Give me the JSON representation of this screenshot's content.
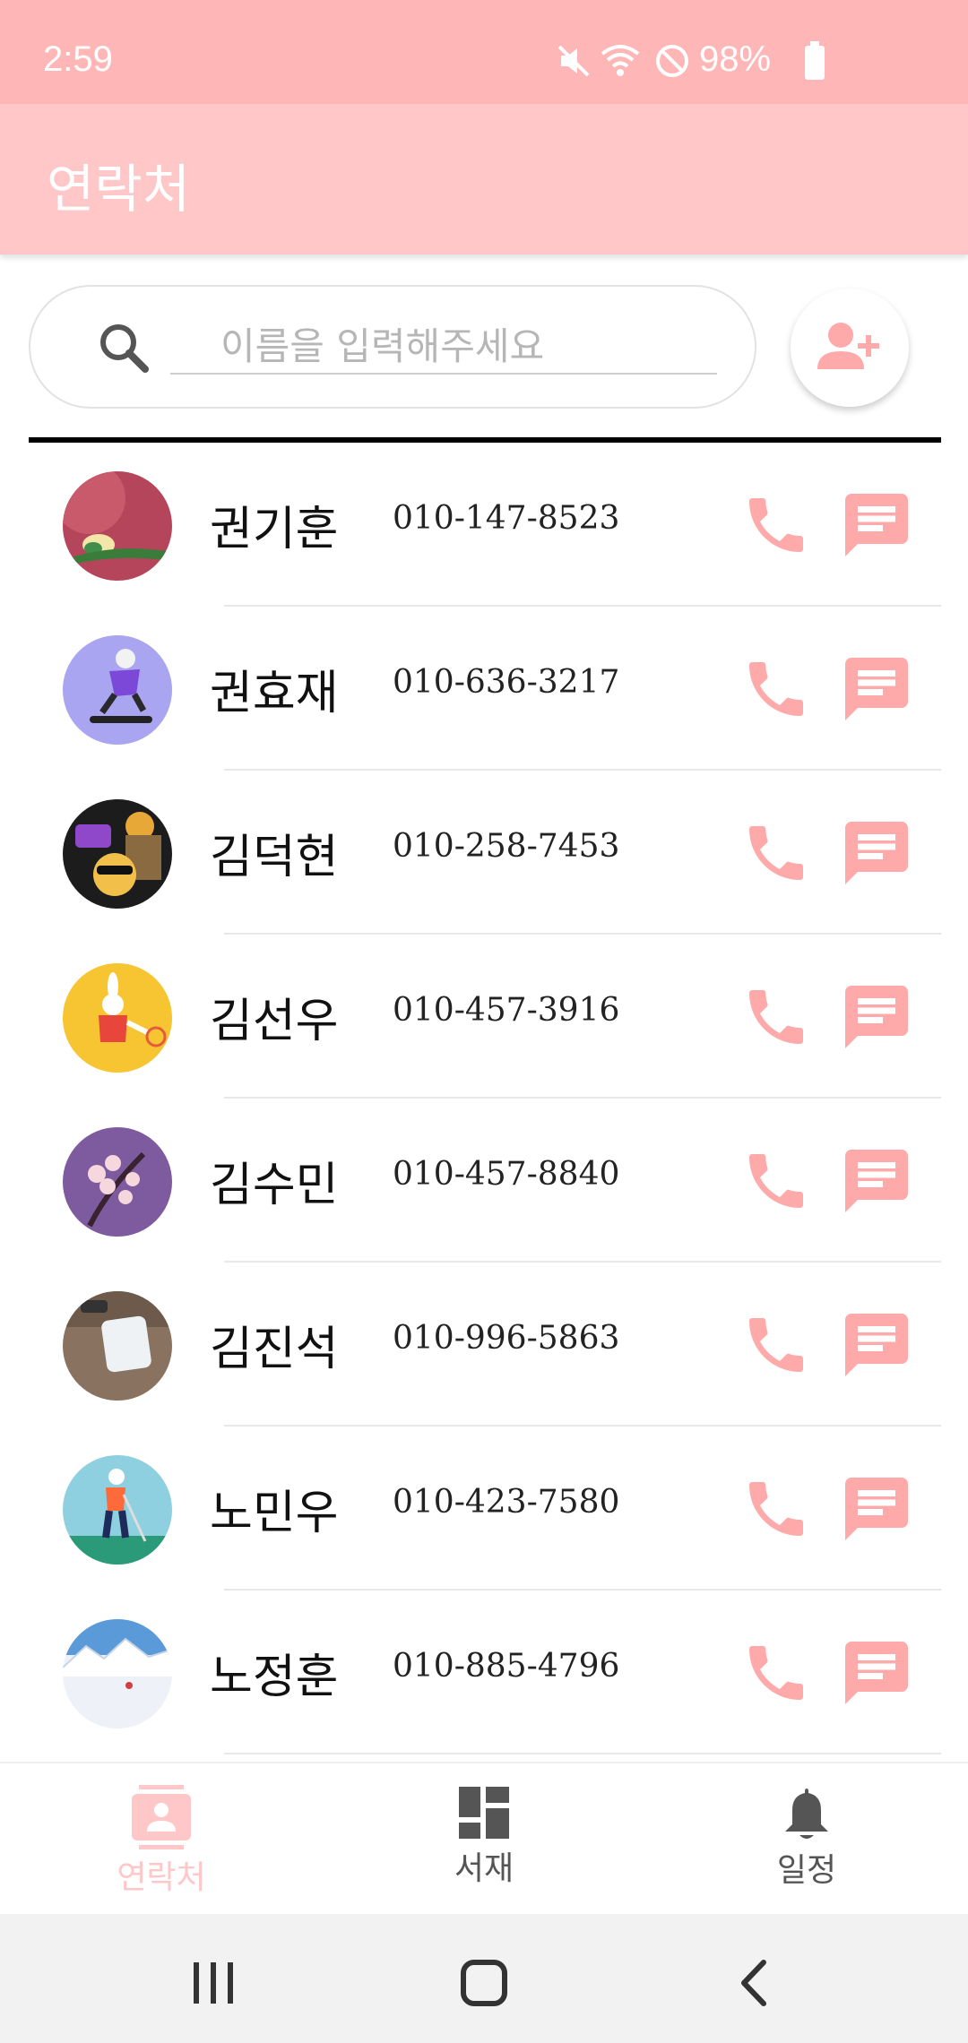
{
  "status_bar": {
    "time": "2:59",
    "battery": "98%"
  },
  "app_bar": {
    "title": "연락처"
  },
  "search": {
    "placeholder": "이름을 입력해주세요"
  },
  "colors": {
    "accent": "#ffaaaa",
    "app_bar": "#ffc7c7",
    "status_bar": "#ffb6b6"
  },
  "contacts": [
    {
      "name": "권기훈",
      "phone": "010-147-8523"
    },
    {
      "name": "권효재",
      "phone": "010-636-3217"
    },
    {
      "name": "김덕현",
      "phone": "010-258-7453"
    },
    {
      "name": "김선우",
      "phone": "010-457-3916"
    },
    {
      "name": "김수민",
      "phone": "010-457-8840"
    },
    {
      "name": "김진석",
      "phone": "010-996-5863"
    },
    {
      "name": "노민우",
      "phone": "010-423-7580"
    },
    {
      "name": "노정훈",
      "phone": "010-885-4796"
    }
  ],
  "bottom_nav": [
    {
      "label": "연락처",
      "icon": "contact-card-icon",
      "active": true
    },
    {
      "label": "서재",
      "icon": "dashboard-icon",
      "active": false
    },
    {
      "label": "일정",
      "icon": "bell-icon",
      "active": false
    }
  ]
}
